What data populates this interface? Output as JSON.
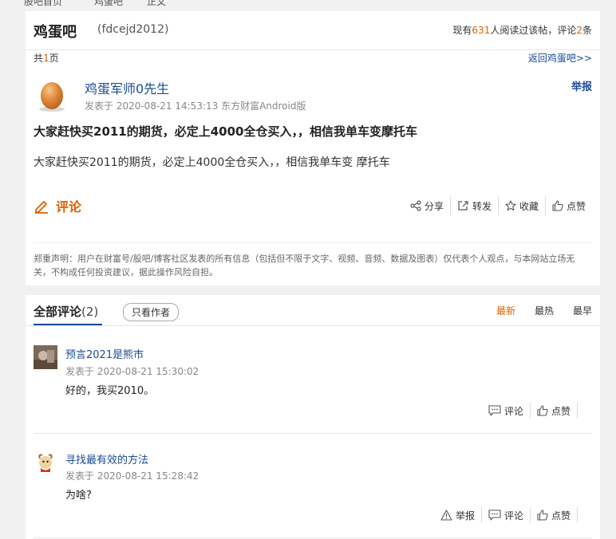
{
  "top_strip": {
    "items": [
      "股吧首页",
      "鸡蛋吧",
      "正文"
    ]
  },
  "post": {
    "bar_name": "鸡蛋吧",
    "bar_code": "(fdcejd2012)",
    "stats_prefix": "现有",
    "read_count": "631",
    "stats_middle": "人阅读过该帖，评论",
    "comment_count": "2",
    "stats_suffix": "条",
    "pages_prefix": "共",
    "pages_count": "1",
    "pages_suffix": "页",
    "back_link": "返回鸡蛋吧>>",
    "author": "鸡蛋军师0先生",
    "report_label": "举报",
    "meta": "发表于 2020-08-21 14:53:13 东方财富Android版",
    "title": "大家赶快买2011的期货，必定上4000全仓买入，，相信我单车变摩托车",
    "body": "大家赶快买2011的期货，必定上4000全仓买入，，相信我单车变 摩托车",
    "comment_label": "评论",
    "actions": {
      "share": "分享",
      "repost": "转发",
      "favorite": "收藏",
      "like": "点赞"
    },
    "disclaimer": "郑重声明：用户在财富号/股吧/博客社区发表的所有信息（包括但不限于文字、视频、音频、数据及图表）仅代表个人观点，与本网站立场无关，不构成任何投资建议，据此操作风险自担。"
  },
  "comments_section": {
    "title": "全部评论",
    "count": "(2)",
    "only_author": "只看作者",
    "sorts": [
      "最新",
      "最热",
      "最早"
    ],
    "active_sort": "最新",
    "comments": [
      {
        "name": "预言2021是熊市",
        "meta": "发表于 2020-08-21 15:30:02",
        "text": "好的，我买2010。",
        "actions": {
          "comment": "评论",
          "like": "点赞"
        }
      },
      {
        "name": "寻找最有效的方法",
        "meta": "发表于 2020-08-21 15:28:42",
        "text": "为啥?",
        "actions": {
          "report": "举报",
          "comment": "评论",
          "like": "点赞"
        }
      }
    ]
  },
  "colors": {
    "accent": "#e06100",
    "link": "#1a4b96",
    "background": "#f1f1f1"
  }
}
